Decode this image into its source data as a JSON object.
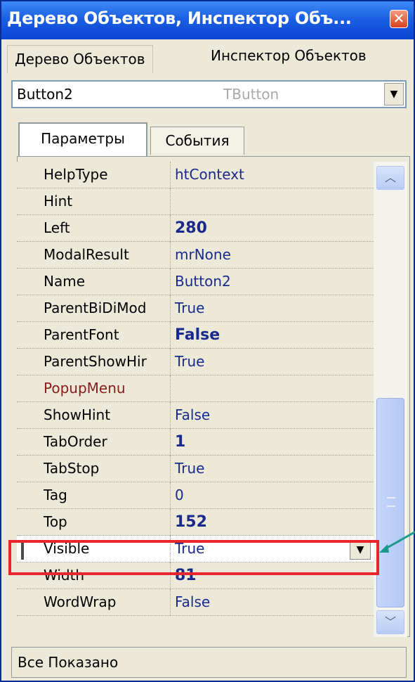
{
  "window": {
    "title": "Дерево Объектов, Инспектор Объ..."
  },
  "tabs_top": {
    "tree": "Дерево Объектов",
    "inspector": "Инспектор Объектов"
  },
  "component": {
    "name": "Button2",
    "type": "TButton"
  },
  "tabs": {
    "params": "Параметры",
    "events": "События"
  },
  "properties": [
    {
      "name": "HelpType",
      "value": "htContext",
      "bold": false
    },
    {
      "name": "Hint",
      "value": "",
      "bold": false
    },
    {
      "name": "Left",
      "value": "280",
      "bold": true
    },
    {
      "name": "ModalResult",
      "value": "mrNone",
      "bold": false
    },
    {
      "name": "Name",
      "value": "Button2",
      "bold": false
    },
    {
      "name": "ParentBiDiMod",
      "value": "True",
      "bold": false
    },
    {
      "name": "ParentFont",
      "value": "False",
      "bold": true
    },
    {
      "name": "ParentShowHir",
      "value": "True",
      "bold": false
    },
    {
      "name": "PopupMenu",
      "value": "",
      "bold": false,
      "ref": true
    },
    {
      "name": "ShowHint",
      "value": "False",
      "bold": false
    },
    {
      "name": "TabOrder",
      "value": "1",
      "bold": true
    },
    {
      "name": "TabStop",
      "value": "True",
      "bold": false
    },
    {
      "name": "Tag",
      "value": "0",
      "bold": false
    },
    {
      "name": "Top",
      "value": "152",
      "bold": true
    },
    {
      "name": "Visible",
      "value": "True",
      "bold": false,
      "selected": true
    },
    {
      "name": "Width",
      "value": "81",
      "bold": true
    },
    {
      "name": "WordWrap",
      "value": "False",
      "bold": false
    }
  ],
  "status": {
    "text": "Все Показано"
  },
  "colors": {
    "highlight": "#e8262b",
    "callout": "#1a9a8c",
    "title_bar": "#0845d2"
  }
}
